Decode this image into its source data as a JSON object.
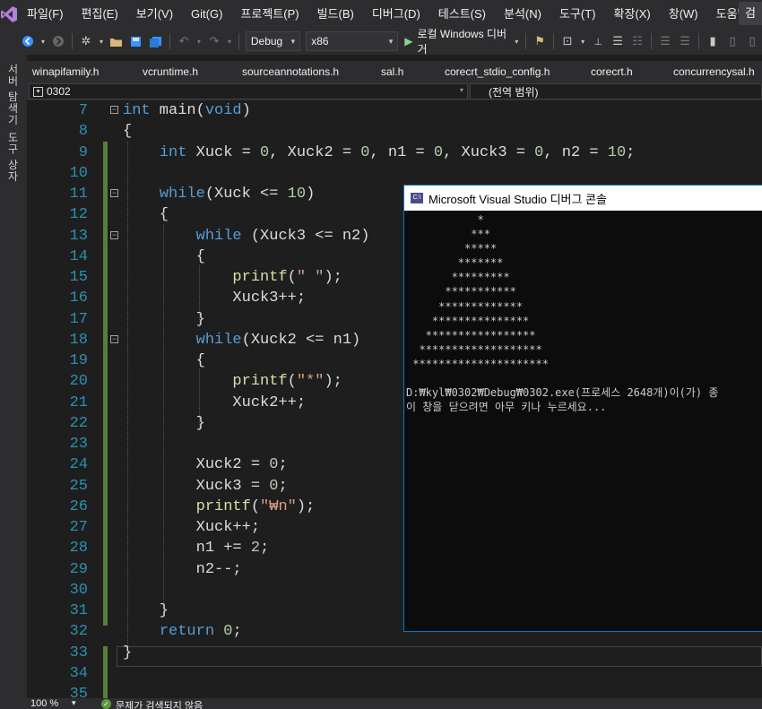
{
  "menubar": {
    "items": [
      "파일(F)",
      "편집(E)",
      "보기(V)",
      "Git(G)",
      "프로젝트(P)",
      "빌드(B)",
      "디버그(D)",
      "테스트(S)",
      "분석(N)",
      "도구(T)",
      "확장(X)",
      "창(W)",
      "도움말(H)"
    ],
    "right": "검"
  },
  "toolbar": {
    "config": "Debug",
    "platform": "x86",
    "run_label": "로컬 Windows 디버거"
  },
  "sidebar": {
    "tab1": "서버 탐색기",
    "tab2": "도구 상자"
  },
  "tabs": [
    "winapifamily.h",
    "vcruntime.h",
    "sourceannotations.h",
    "sal.h",
    "corecrt_stdio_config.h",
    "corecrt.h",
    "concurrencysal.h"
  ],
  "nav": {
    "left": "0302",
    "right": "(전역 범위)"
  },
  "code": {
    "lines": [
      {
        "n": "7",
        "fold": true,
        "tokens": [
          {
            "t": "int",
            "c": "kw"
          },
          {
            "t": " main(",
            "c": ""
          },
          {
            "t": "void",
            "c": "kw"
          },
          {
            "t": ")",
            "c": ""
          }
        ]
      },
      {
        "n": "8",
        "tokens": [
          {
            "t": "{",
            "c": ""
          }
        ]
      },
      {
        "n": "9",
        "tokens": [
          {
            "t": "    ",
            "c": ""
          },
          {
            "t": "int",
            "c": "kw"
          },
          {
            "t": " Xuck = ",
            "c": ""
          },
          {
            "t": "0",
            "c": "num"
          },
          {
            "t": ", Xuck2 = ",
            "c": ""
          },
          {
            "t": "0",
            "c": "num"
          },
          {
            "t": ", n1 = ",
            "c": ""
          },
          {
            "t": "0",
            "c": "num"
          },
          {
            "t": ", Xuck3 = ",
            "c": ""
          },
          {
            "t": "0",
            "c": "num"
          },
          {
            "t": ", n2 = ",
            "c": ""
          },
          {
            "t": "10",
            "c": "num"
          },
          {
            "t": ";",
            "c": ""
          }
        ]
      },
      {
        "n": "10",
        "tokens": []
      },
      {
        "n": "11",
        "fold": true,
        "tokens": [
          {
            "t": "    ",
            "c": ""
          },
          {
            "t": "while",
            "c": "kw"
          },
          {
            "t": "(Xuck <= ",
            "c": ""
          },
          {
            "t": "10",
            "c": "num"
          },
          {
            "t": ")",
            "c": ""
          }
        ]
      },
      {
        "n": "12",
        "tokens": [
          {
            "t": "    {",
            "c": ""
          }
        ]
      },
      {
        "n": "13",
        "fold": true,
        "tokens": [
          {
            "t": "        ",
            "c": ""
          },
          {
            "t": "while",
            "c": "kw"
          },
          {
            "t": " (Xuck3 <= n2)",
            "c": ""
          }
        ]
      },
      {
        "n": "14",
        "tokens": [
          {
            "t": "        {",
            "c": ""
          }
        ]
      },
      {
        "n": "15",
        "tokens": [
          {
            "t": "            ",
            "c": ""
          },
          {
            "t": "printf",
            "c": "fn"
          },
          {
            "t": "(",
            "c": ""
          },
          {
            "t": "\" \"",
            "c": "str"
          },
          {
            "t": ");",
            "c": ""
          }
        ]
      },
      {
        "n": "16",
        "tokens": [
          {
            "t": "            Xuck3++;",
            "c": ""
          }
        ]
      },
      {
        "n": "17",
        "tokens": [
          {
            "t": "        }",
            "c": ""
          }
        ]
      },
      {
        "n": "18",
        "fold": true,
        "tokens": [
          {
            "t": "        ",
            "c": ""
          },
          {
            "t": "while",
            "c": "kw"
          },
          {
            "t": "(Xuck2 <= n1)",
            "c": ""
          }
        ]
      },
      {
        "n": "19",
        "tokens": [
          {
            "t": "        {",
            "c": ""
          }
        ]
      },
      {
        "n": "20",
        "tokens": [
          {
            "t": "            ",
            "c": ""
          },
          {
            "t": "printf",
            "c": "fn"
          },
          {
            "t": "(",
            "c": ""
          },
          {
            "t": "\"*\"",
            "c": "str"
          },
          {
            "t": ");",
            "c": ""
          }
        ]
      },
      {
        "n": "21",
        "tokens": [
          {
            "t": "            Xuck2++;",
            "c": ""
          }
        ]
      },
      {
        "n": "22",
        "tokens": [
          {
            "t": "        }",
            "c": ""
          }
        ]
      },
      {
        "n": "23",
        "tokens": []
      },
      {
        "n": "24",
        "tokens": [
          {
            "t": "        Xuck2 = ",
            "c": ""
          },
          {
            "t": "0",
            "c": "num"
          },
          {
            "t": ";",
            "c": ""
          }
        ]
      },
      {
        "n": "25",
        "tokens": [
          {
            "t": "        Xuck3 = ",
            "c": ""
          },
          {
            "t": "0",
            "c": "num"
          },
          {
            "t": ";",
            "c": ""
          }
        ]
      },
      {
        "n": "26",
        "tokens": [
          {
            "t": "        ",
            "c": ""
          },
          {
            "t": "printf",
            "c": "fn"
          },
          {
            "t": "(",
            "c": ""
          },
          {
            "t": "\"₩n\"",
            "c": "str"
          },
          {
            "t": ");",
            "c": ""
          }
        ]
      },
      {
        "n": "27",
        "tokens": [
          {
            "t": "        Xuck++;",
            "c": ""
          }
        ]
      },
      {
        "n": "28",
        "tokens": [
          {
            "t": "        n1 += ",
            "c": ""
          },
          {
            "t": "2",
            "c": "num"
          },
          {
            "t": ";",
            "c": ""
          }
        ]
      },
      {
        "n": "29",
        "tokens": [
          {
            "t": "        n2--;",
            "c": ""
          }
        ]
      },
      {
        "n": "30",
        "tokens": []
      },
      {
        "n": "31",
        "tokens": [
          {
            "t": "    }",
            "c": ""
          }
        ]
      },
      {
        "n": "32",
        "tokens": [
          {
            "t": "    ",
            "c": ""
          },
          {
            "t": "return",
            "c": "kw"
          },
          {
            "t": " ",
            "c": ""
          },
          {
            "t": "0",
            "c": "num"
          },
          {
            "t": ";",
            "c": ""
          }
        ]
      },
      {
        "n": "33",
        "tokens": [
          {
            "t": "}",
            "c": ""
          }
        ]
      },
      {
        "n": "34",
        "tokens": []
      },
      {
        "n": "35",
        "tokens": []
      }
    ]
  },
  "console": {
    "title": "Microsoft Visual Studio 디버그 콘솔",
    "icon": "C:\\",
    "output": [
      "           *",
      "          ***",
      "         *****",
      "        *******",
      "       *********",
      "      ***********",
      "     *************",
      "    ***************",
      "   *****************",
      "  *******************",
      " *********************",
      "",
      "D:₩kyl₩0302₩Debug₩0302.exe(프로세스 2648개)이(가) 종",
      "이 창을 닫으려면 아무 키나 누르세요..."
    ]
  },
  "status": {
    "zoom": "100 %",
    "message": "문제가 검색되지 않음"
  }
}
